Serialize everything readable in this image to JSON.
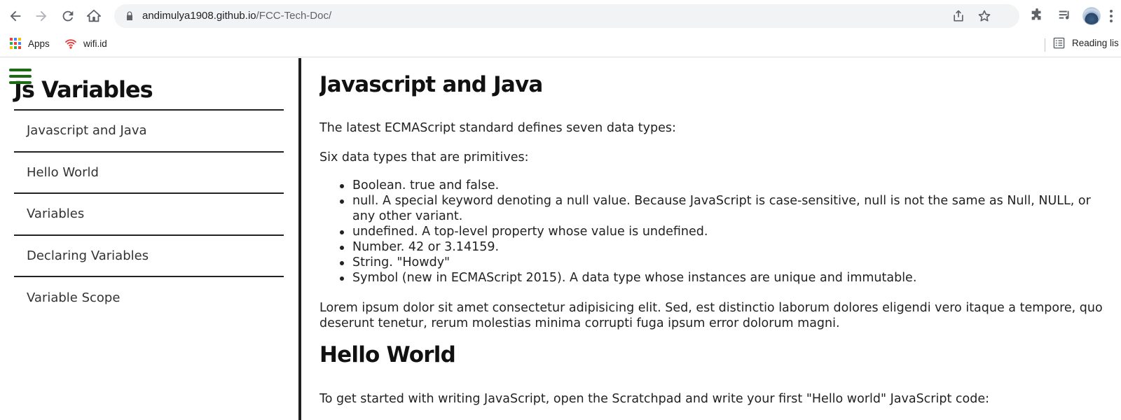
{
  "browser": {
    "url_host": "andimulya1908.github.io",
    "url_path": "/FCC-Tech-Doc/",
    "bookmarks": [
      {
        "label": "Apps"
      },
      {
        "label": "wifi.id"
      }
    ],
    "reading_list_label": "Reading lis"
  },
  "sidebar": {
    "title": "Js Variables",
    "items": [
      {
        "label": "Javascript and Java"
      },
      {
        "label": "Hello World"
      },
      {
        "label": "Variables"
      },
      {
        "label": "Declaring Variables"
      },
      {
        "label": "Variable Scope"
      }
    ]
  },
  "main": {
    "section1": {
      "heading": "Javascript and Java",
      "intro": "The latest ECMAScript standard defines seven data types:",
      "sub": "Six data types that are primitives:",
      "list": [
        "Boolean. true and false.",
        "null. A special keyword denoting a null value. Because JavaScript is case-sensitive, null is not the same as Null, NULL, or any other variant.",
        "undefined. A top-level property whose value is undefined.",
        "Number. 42 or 3.14159.",
        "String. \"Howdy\"",
        "Symbol (new in ECMAScript 2015). A data type whose instances are unique and immutable."
      ],
      "lorem": "Lorem ipsum dolor sit amet consectetur adipisicing elit. Sed, est distinctio laborum dolores eligendi vero itaque a tempore, quo deserunt tenetur, rerum molestias minima corrupti fuga ipsum error dolorum magni."
    },
    "section2": {
      "heading": "Hello World",
      "intro": "To get started with writing JavaScript, open the Scratchpad and write your first \"Hello world\" JavaScript code:"
    }
  }
}
